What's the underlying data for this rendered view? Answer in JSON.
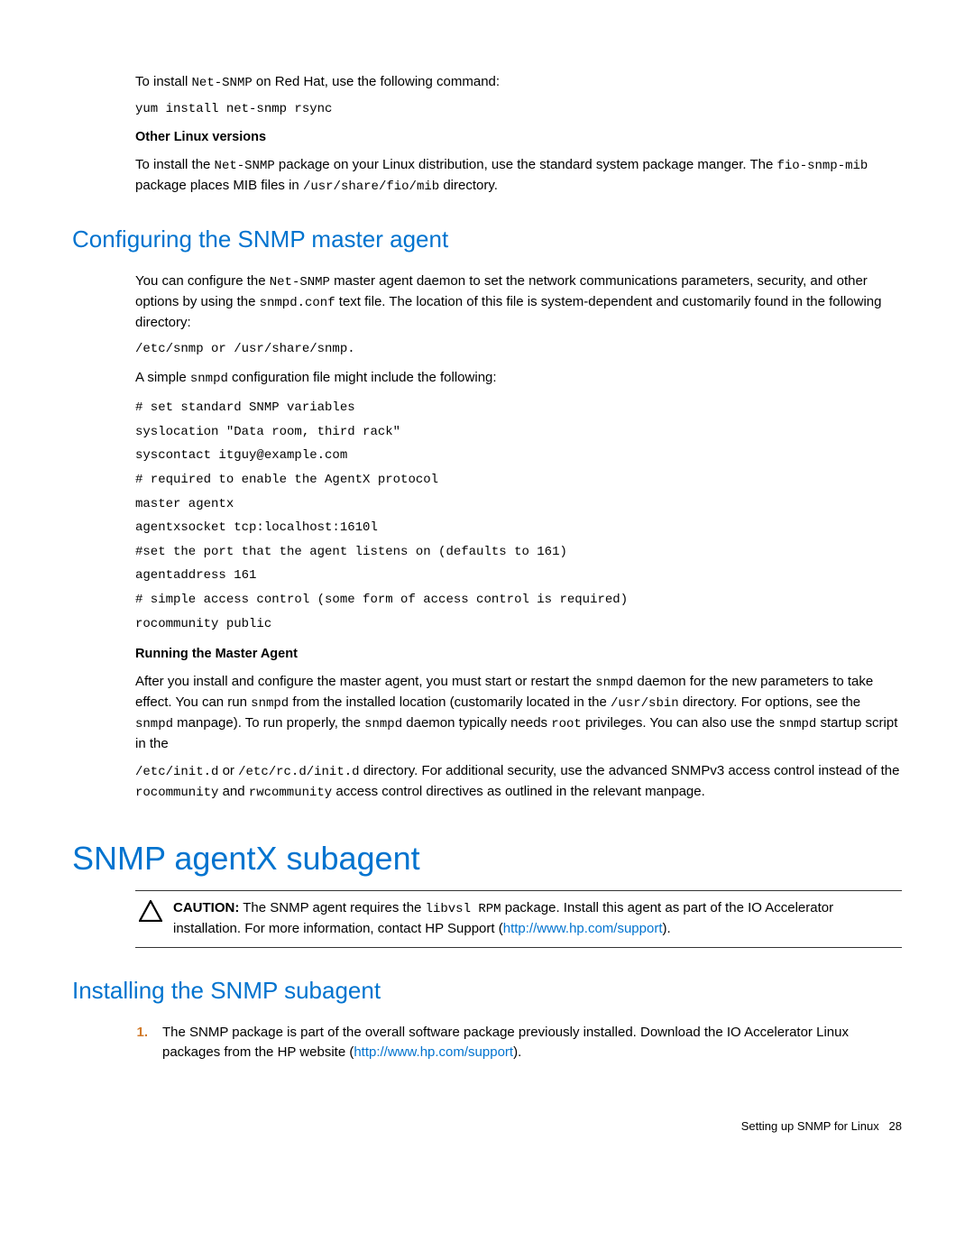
{
  "intro": {
    "p1_before": "To install ",
    "p1_code": "Net-SNMP",
    "p1_after": " on Red Hat, use the following command:",
    "cmd1": "yum install net-snmp rsync",
    "sub1": "Other Linux versions",
    "p2_before": "To install the ",
    "p2_code1": "Net-SNMP",
    "p2_mid1": " package on your Linux distribution, use the standard system package manger. The ",
    "p2_code2": "fio-snmp-mib",
    "p2_mid2": " package places MIB files in ",
    "p2_code3": "/usr/share/fio/mib",
    "p2_after": " directory."
  },
  "sec1": {
    "heading": "Configuring the SNMP master agent",
    "p1_before": "You can configure the ",
    "p1_code1": "Net-SNMP",
    "p1_mid1": " master agent daemon to set the network communications parameters, security, and other options by using the ",
    "p1_code2": "snmpd.conf",
    "p1_after": " text file. The location of this file is system-dependent and customarily found in the following directory:",
    "path1": "/etc/snmp or /usr/share/snmp.",
    "p2_before": "A simple ",
    "p2_code": "snmpd",
    "p2_after": " configuration file might include the following:",
    "codeblock": "# set standard SNMP variables\nsyslocation \"Data room, third rack\"\nsyscontact itguy@example.com\n# required to enable the AgentX protocol\nmaster agentx\nagentxsocket tcp:localhost:1610l\n#set the port that the agent listens on (defaults to 161)\nagentaddress 161\n# simple access control (some form of access control is required)\nrocommunity public",
    "sub1": "Running the Master Agent",
    "p3_before": "After you install and configure the master agent, you must start or restart the ",
    "p3_c1": "snmpd",
    "p3_m1": " daemon for the new parameters to take effect. You can run ",
    "p3_c2": "snmpd",
    "p3_m2": " from the installed location (customarily located in the ",
    "p3_c3": "/usr/sbin",
    "p3_m3": " directory. For options, see the ",
    "p3_c4": "snmpd",
    "p3_m4": " manpage). To run properly, the ",
    "p3_c5": "snmpd",
    "p3_m5": " daemon typically needs ",
    "p3_c6": "root",
    "p3_m6": " privileges. You can also use the ",
    "p3_c7": "snmpd",
    "p3_m7": " startup script in the",
    "p4_c1": "/etc/init.d",
    "p4_m1": " or ",
    "p4_c2": "/etc/rc.d/init.d",
    "p4_m2": " directory. For additional security, use the advanced SNMPv3 access control instead of the ",
    "p4_c3": "rocommunity",
    "p4_m3": " and ",
    "p4_c4": "rwcommunity",
    "p4_m4": " access control directives as outlined in the relevant manpage."
  },
  "sec2": {
    "heading": "SNMP agentX subagent",
    "caution_label": "CAUTION:",
    "caution_before": "  The SNMP agent requires the ",
    "caution_code": "libvsl RPM",
    "caution_mid": " package. Install this agent as part of the IO Accelerator installation. For more information, contact HP Support (",
    "caution_link": "http://www.hp.com/support",
    "caution_after": ")."
  },
  "sec3": {
    "heading": "Installing the SNMP subagent",
    "item1_num": "1.",
    "item1_before": "The SNMP package is part of the overall software package previously installed. Download the IO Accelerator Linux packages from the HP website (",
    "item1_link": "http://www.hp.com/support",
    "item1_after": ")."
  },
  "footer": {
    "text": "Setting up SNMP for Linux",
    "page": "28"
  }
}
